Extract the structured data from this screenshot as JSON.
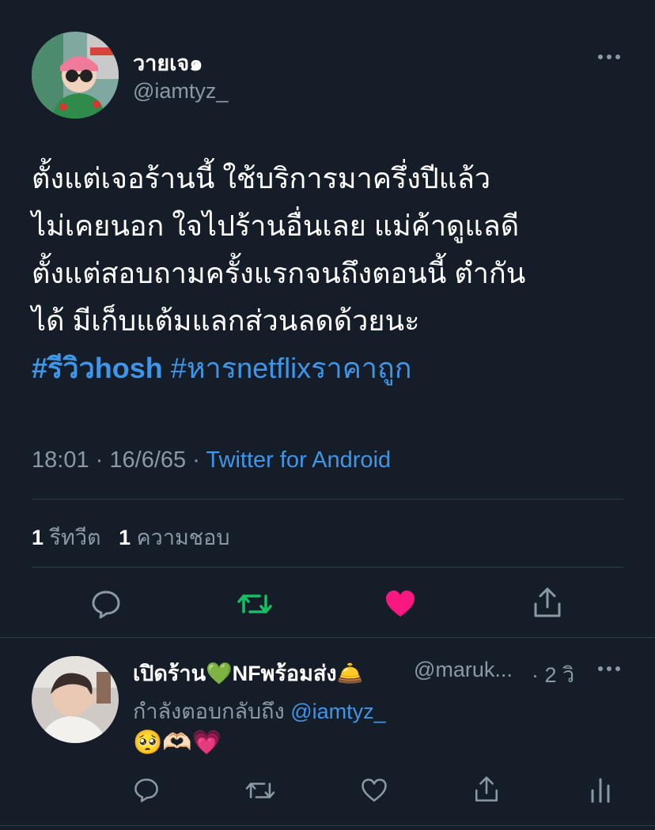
{
  "tweet": {
    "author_name": "วายเจ๑",
    "author_handle": "@iamtyz_",
    "lines": [
      "ตั้งแต่เจอร้านนี้ ใช้บริการมาครึ่งปีแล้ว",
      "ไม่เคยนอก ใจไปร้านอื่นเลย แม่ค้าดูแลดี",
      "ตั้งแต่สอบถามครั้งแรกจนถึงตอนนี้ ตำกัน",
      "ได้ มีเก็บแต้มแลกส่วนลดด้วยนะ"
    ],
    "hashtag_1": "#รีวิวhosh",
    "hashtag_2": "#หารnetflixราคาถูก",
    "time": "18:01",
    "date": "16/6/65",
    "separator": "·",
    "source": "Twitter for Android",
    "retweet_count": "1",
    "retweet_label": "รีทวีต",
    "like_count": "1",
    "like_label": "ความชอบ"
  },
  "reply": {
    "author_name": "เปิดร้าน💚NFพร้อมส่ง🛎️",
    "author_handle": "@maruk...",
    "time_ago": "· 2 วิ",
    "replying_to_label": "กำลังตอบกลับถึง",
    "replying_to_handle": "@iamtyz_",
    "text": "🥺🫶🏻💗"
  },
  "icons": {
    "more": "more-horizontal-icon",
    "reply": "speech-bubble-icon",
    "retweet": "retweet-icon",
    "like": "heart-icon",
    "share": "share-icon",
    "analytics": "bar-chart-icon"
  },
  "colors": {
    "background": "#151d28",
    "accent": "#3f95e8",
    "retweet_active": "#17bf63",
    "like_active": "#f91880",
    "muted": "#8b98a5"
  }
}
